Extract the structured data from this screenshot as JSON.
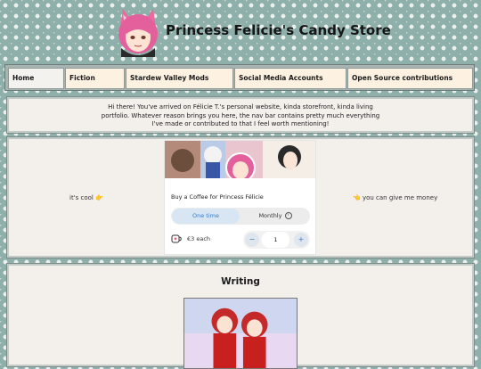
{
  "site": {
    "title": "Princess Felicie's Candy Store"
  },
  "nav": {
    "items": [
      {
        "label": "Home"
      },
      {
        "label": "Fiction"
      },
      {
        "label": "Stardew Valley Mods"
      },
      {
        "label": "Social Media Accounts"
      },
      {
        "label": "Open Source contributions"
      }
    ]
  },
  "intro": {
    "text": "Hi there! You've arrived on Félicie T.'s personal website, kinda storefront, kinda living portfolio. Whatever reason brings you here, the nav bar contains pretty much everything I've made or contributed to that I feel worth mentioning!"
  },
  "support": {
    "left_text": "it's cool 👉",
    "right_text": "👈 you can give me money",
    "widget": {
      "title": "Buy a Coffee for Princess Félicie",
      "tab_once": "One time",
      "tab_monthly": "Monthly",
      "price": "€3 each",
      "quantity": "1",
      "minus": "−",
      "plus": "+",
      "info_glyph": "i"
    }
  },
  "writing": {
    "heading": "Writing"
  },
  "colors": {
    "background": "#8fb0aa",
    "nav_item": "#fdf2e1",
    "panel": "#f3f0ec",
    "accent": "#3a78c2"
  }
}
